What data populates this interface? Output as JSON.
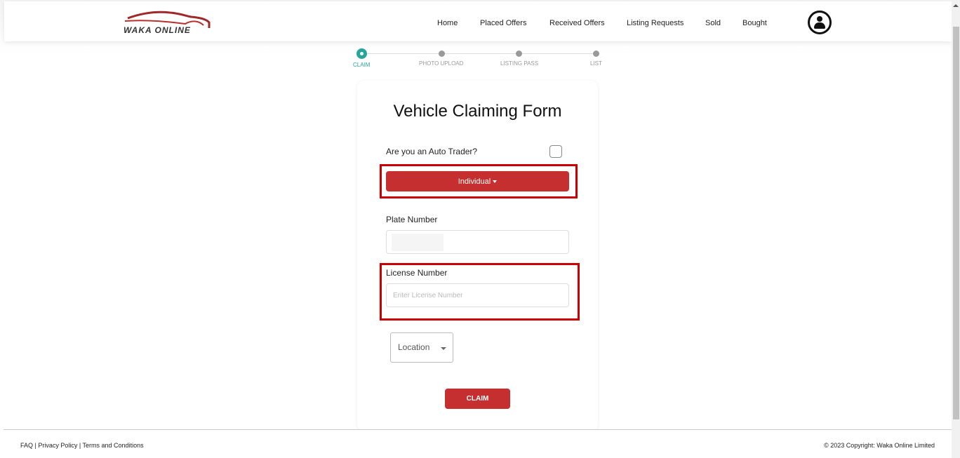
{
  "brand": {
    "logo_text": "WAKA ONLINE",
    "accent": "#c62f2f",
    "step_color": "#26a69a"
  },
  "nav": {
    "items": [
      "Home",
      "Placed Offers",
      "Received Offers",
      "Listing Requests",
      "Sold",
      "Bought"
    ],
    "profile_icon": "user-circle-icon"
  },
  "steps": [
    {
      "label": "CLAIM",
      "active": true
    },
    {
      "label": "PHOTO UPLOAD",
      "active": false
    },
    {
      "label": "LISTING PASS",
      "active": false
    },
    {
      "label": "LIST",
      "active": false
    }
  ],
  "form": {
    "title": "Vehicle Claiming Form",
    "auto_trader_label": "Are you an Auto Trader?",
    "auto_trader_checked": false,
    "type_dropdown": "Individual",
    "plate_label": "Plate Number",
    "plate_value": "",
    "license_label": "License Number",
    "license_placeholder": "Enter License Number",
    "location_select": "Location",
    "claim_button": "CLAIM"
  },
  "footer": {
    "links": "FAQ | Privacy Policy | Terms and Conditions",
    "copyright": "© 2023 Copyright: Waka Online Limited"
  }
}
